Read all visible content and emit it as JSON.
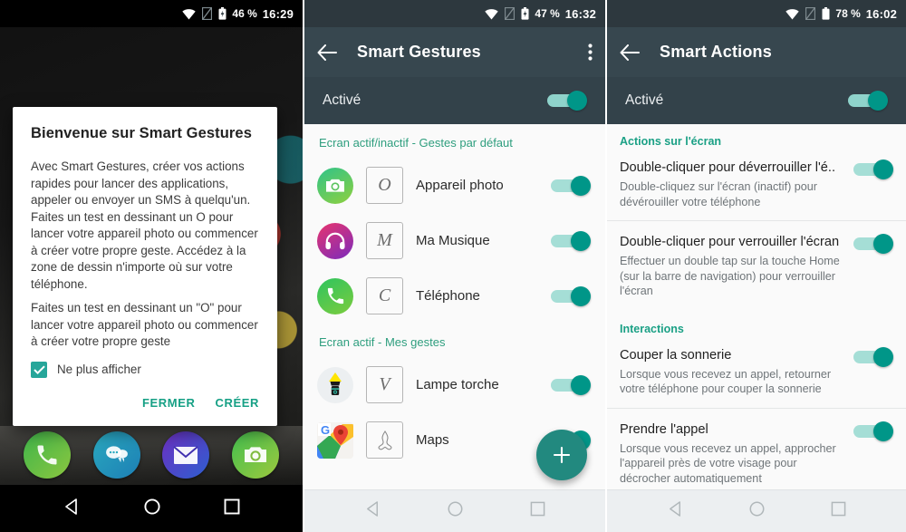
{
  "panel1": {
    "status": {
      "battery_pct": "46 %",
      "time": "16:29",
      "icons": [
        "wifi-icon",
        "sim-card-icon",
        "battery-charging-icon"
      ]
    },
    "dialog": {
      "title": "Bienvenue sur Smart Gestures",
      "paragraphs": [
        "Avec Smart Gestures, créer vos actions rapides pour lancer des applications, appeler ou envoyer un SMS à quelqu'un. Faites un test en dessinant un O pour lancer votre appareil photo ou commencer à créer votre propre geste. Accédez à la zone de dessin n'importe où sur votre téléphone.",
        "Faites un test en dessinant un \"O\" pour lancer votre appareil photo ou commencer à créer votre propre geste"
      ],
      "checkbox_label": "Ne plus afficher",
      "checkbox_checked": true,
      "close_label": "FERMER",
      "create_label": "CRÉER",
      "accent_color": "#16a085"
    },
    "home": {
      "page_dots": 4,
      "active_dot": 1,
      "dock": [
        {
          "name": "phone-app-icon",
          "label": "Téléphone"
        },
        {
          "name": "messages-app-icon",
          "label": "SMS"
        },
        {
          "name": "email-app-icon",
          "label": "E-mail"
        },
        {
          "name": "camera-app-icon",
          "label": "Appareil photo"
        }
      ]
    },
    "navbar": {
      "back": "back-icon",
      "home": "home-icon",
      "recents": "recents-icon"
    }
  },
  "panel2": {
    "status": {
      "battery_pct": "47 %",
      "time": "16:32",
      "icons": [
        "wifi-icon",
        "sim-card-icon",
        "battery-charging-icon"
      ]
    },
    "appbar": {
      "back_icon": "back-arrow-icon",
      "title": "Smart Gestures",
      "overflow_icon": "overflow-menu-icon"
    },
    "master_switch": {
      "label": "Activé",
      "on": true
    },
    "sections": [
      {
        "header": "Ecran actif/inactif - Gestes par défaut",
        "rows": [
          {
            "icon": "camera-icon",
            "gesture": "O",
            "label": "Appareil photo",
            "on": true
          },
          {
            "icon": "headphones-icon",
            "gesture": "M",
            "label": "Ma Musique",
            "on": true
          },
          {
            "icon": "phone-icon",
            "gesture": "C",
            "label": "Téléphone",
            "on": true
          }
        ]
      },
      {
        "header": "Ecran actif - Mes gestes",
        "rows": [
          {
            "icon": "flashlight-icon",
            "gesture": "V",
            "label": "Lampe torche",
            "on": true
          },
          {
            "icon": "maps-icon",
            "gesture": "A",
            "label": "Maps",
            "on": true
          }
        ]
      }
    ],
    "fab": {
      "icon": "plus-icon",
      "color": "#22897f"
    },
    "navbar": {
      "back": "back-icon",
      "home": "home-icon",
      "recents": "recents-icon"
    }
  },
  "panel3": {
    "status": {
      "battery_pct": "78 %",
      "time": "16:02",
      "icons": [
        "wifi-icon",
        "sim-card-icon",
        "battery-full-icon"
      ]
    },
    "appbar": {
      "back_icon": "back-arrow-icon",
      "title": "Smart Actions"
    },
    "master_switch": {
      "label": "Activé",
      "on": true
    },
    "sections": [
      {
        "header": "Actions sur l'écran",
        "rows": [
          {
            "title": "Double-cliquer pour déverrouiller l'é..",
            "desc": "Double-cliquez sur l'écran (inactif) pour dévérouiller votre téléphone",
            "on": true
          },
          {
            "title": "Double-cliquer pour verrouiller l'écran",
            "desc": "Effectuer un double tap sur la touche Home (sur la barre de navigation) pour verrouiller l'écran",
            "on": true
          }
        ]
      },
      {
        "header": "Interactions",
        "rows": [
          {
            "title": "Couper la sonnerie",
            "desc": "Lorsque vous recevez un appel, retourner votre téléphone pour couper la sonnerie",
            "on": true
          },
          {
            "title": "Prendre l'appel",
            "desc": "Lorsque vous recevez un appel, approcher l'appareil près de votre visage pour décrocher automatiquement",
            "on": true
          }
        ]
      }
    ],
    "navbar": {
      "back": "back-icon",
      "home": "home-icon",
      "recents": "recents-icon"
    }
  }
}
